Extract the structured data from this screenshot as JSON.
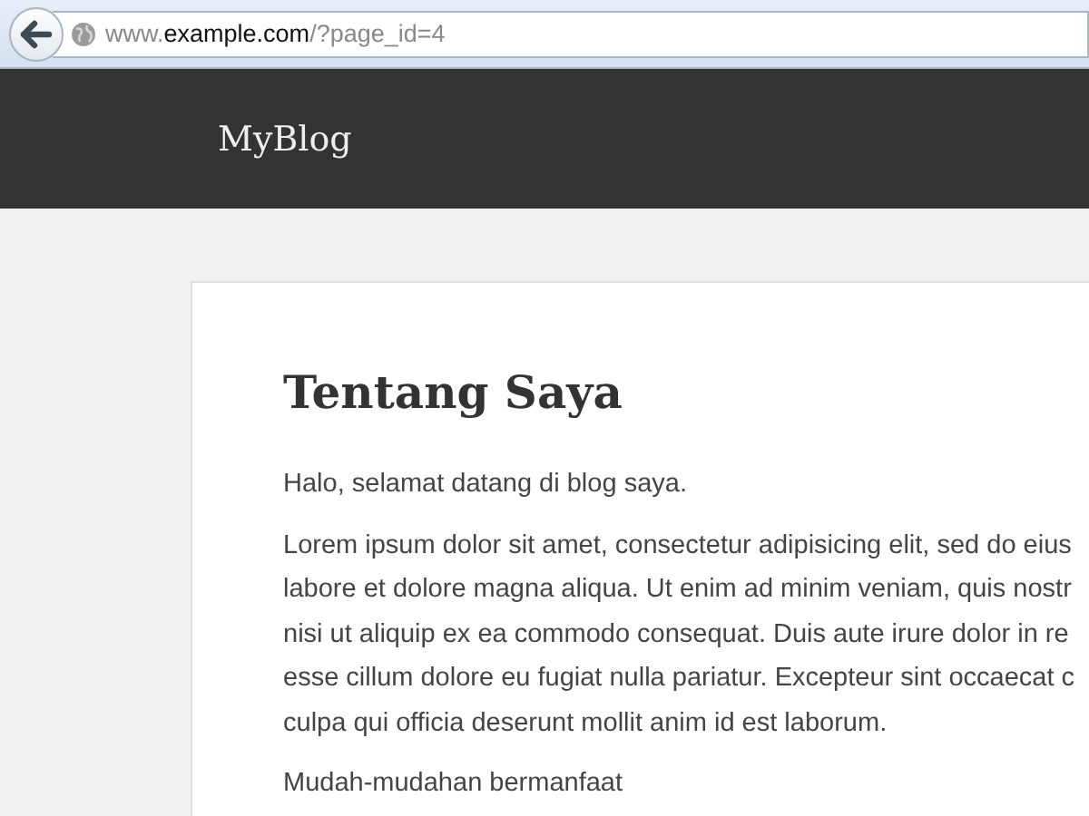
{
  "browser": {
    "url": {
      "prefix": "www.",
      "domain": "example.com",
      "path": "/?page_id=4"
    }
  },
  "site": {
    "title": "MyBlog"
  },
  "post": {
    "title": "Tentang Saya",
    "paragraphs": [
      {
        "lines": [
          "Halo, selamat datang di blog saya."
        ]
      },
      {
        "lines": [
          "Lorem ipsum dolor sit amet, consectetur adipisicing elit, sed do eius",
          "labore et dolore magna aliqua. Ut enim ad minim veniam, quis nostr",
          "nisi ut aliquip ex ea commodo consequat. Duis aute irure dolor in re",
          "esse cillum dolore eu fugiat nulla pariatur. Excepteur sint occaecat c",
          "culpa qui officia deserunt mollit anim id est laborum."
        ]
      },
      {
        "lines": [
          "Mudah-mudahan bermanfaat"
        ]
      }
    ]
  }
}
